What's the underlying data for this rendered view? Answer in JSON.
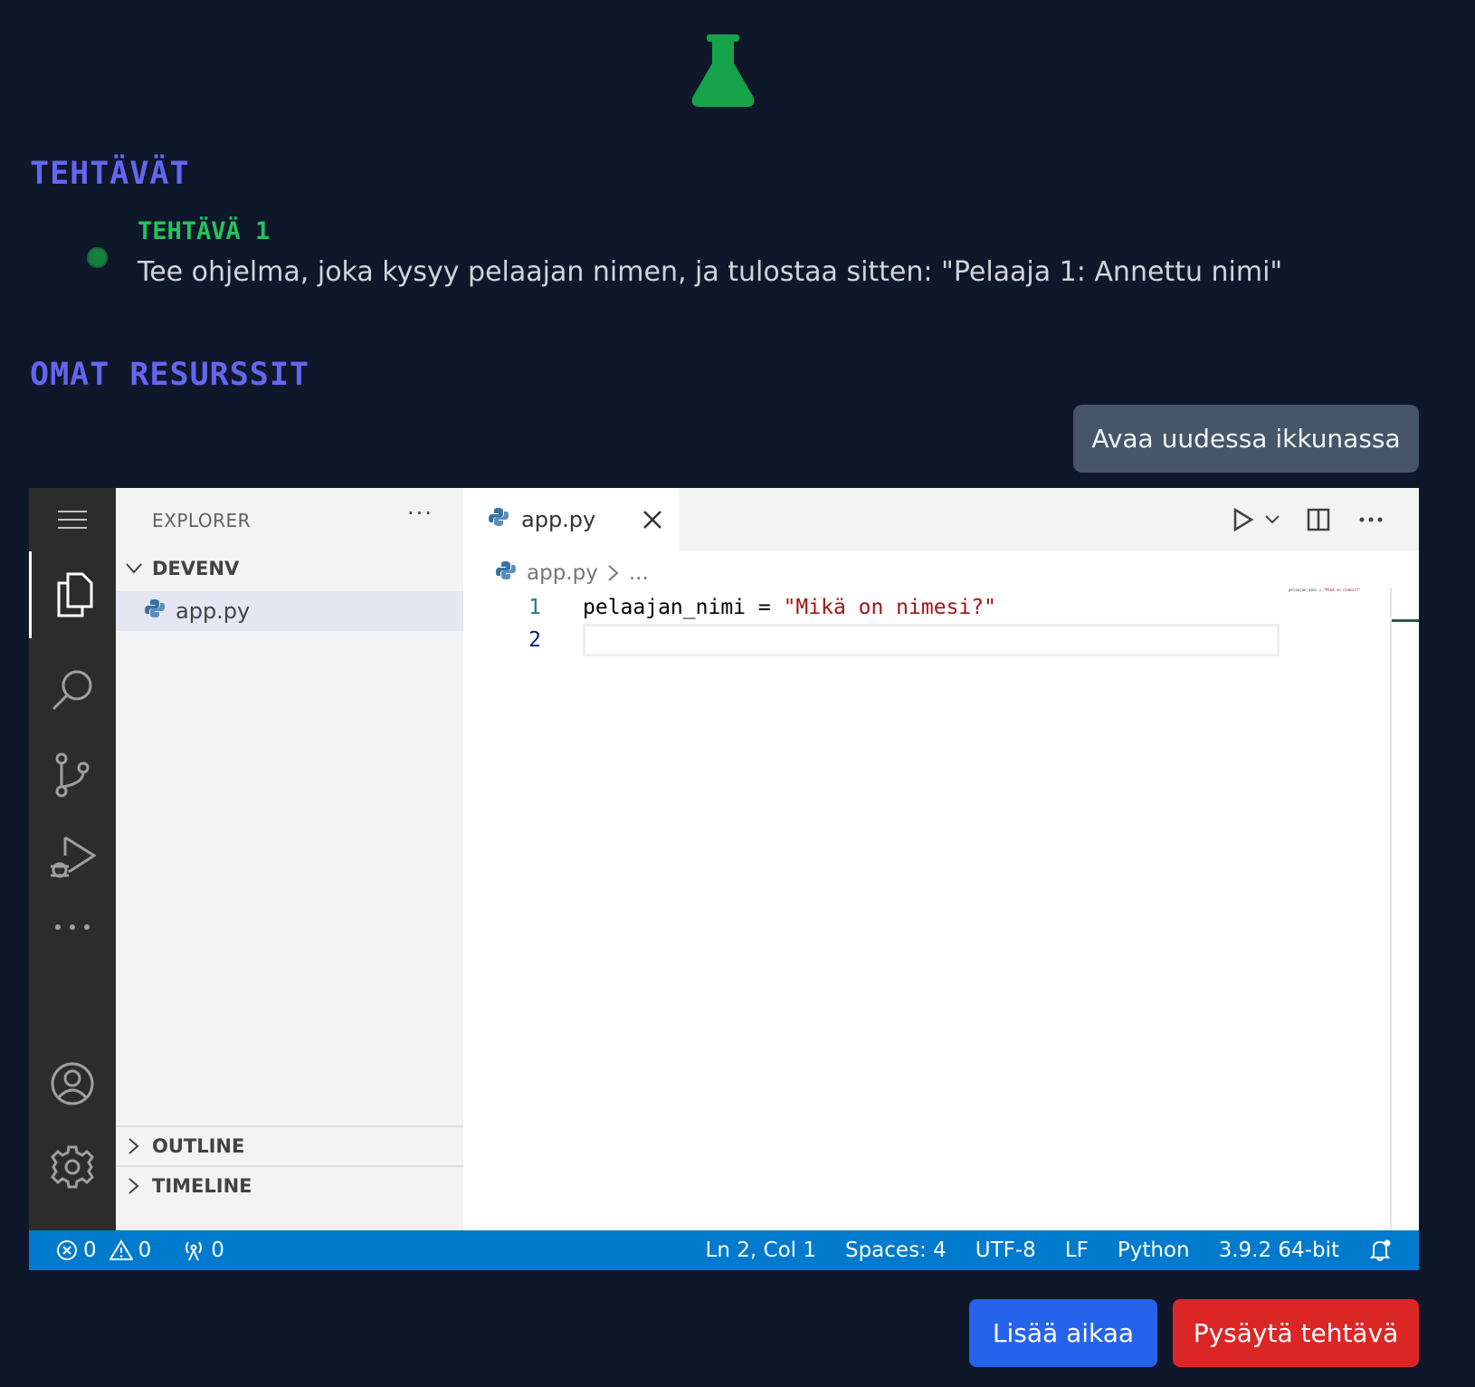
{
  "header": {
    "logo_icon": "flask-icon",
    "logo_color": "#16a34a"
  },
  "tasks_section": {
    "title": "TEHTÄVÄT",
    "items": [
      {
        "title": "TEHTÄVÄ 1",
        "description": "Tee ohjelma, joka kysyy pelaajan nimen, ja tulostaa sitten: \"Pelaaja 1: Annettu nimi\"",
        "status_color": "#15803d"
      }
    ]
  },
  "resources_section": {
    "title": "OMAT RESURSSIT",
    "open_new_window_label": "Avaa uudessa ikkunassa"
  },
  "vscode": {
    "sidebar": {
      "title": "EXPLORER",
      "more": "···",
      "folder": "DEVENV",
      "files": [
        "app.py"
      ],
      "outline": "OUTLINE",
      "timeline": "TIMELINE"
    },
    "tab": {
      "label": "app.py"
    },
    "breadcrumb": {
      "file": "app.py",
      "rest": "..."
    },
    "code": {
      "lines": [
        {
          "number": "1",
          "var": "pelaajan_nimi",
          "op": " = ",
          "str": "\"Mikä on nimesi?\""
        },
        {
          "number": "2",
          "var": "",
          "op": "",
          "str": ""
        }
      ]
    },
    "minimap": {
      "var": "pelaajan_nimi = ",
      "str": "\"Mikä on nimesi?\""
    },
    "statusbar": {
      "errors": "0",
      "warnings": "0",
      "ports": "0",
      "position": "Ln 2, Col 1",
      "spaces": "Spaces: 4",
      "encoding": "UTF-8",
      "eol": "LF",
      "language": "Python",
      "interpreter": "3.9.2 64-bit",
      "color": "#007acc"
    }
  },
  "actions": {
    "add_time_label": "Lisää aikaa",
    "stop_task_label": "Pysäytä tehtävä"
  }
}
